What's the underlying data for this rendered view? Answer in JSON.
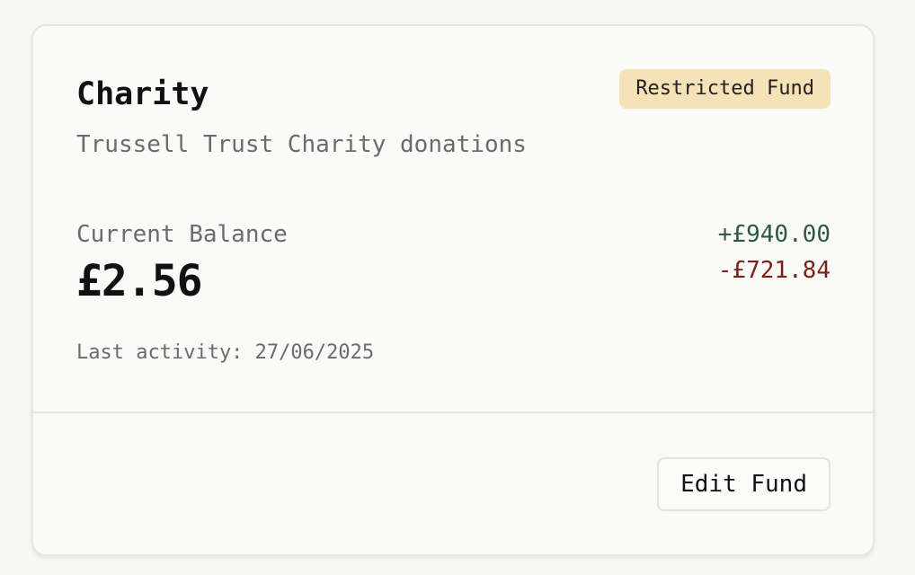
{
  "fund": {
    "name": "Charity",
    "badge": "Restricted Fund",
    "description": "Trussell Trust Charity donations",
    "balance_label": "Current Balance",
    "balance": "£2.56",
    "income": "+£940.00",
    "expense": "-£721.84",
    "last_activity": "Last activity: 27/06/2025"
  },
  "actions": {
    "edit_label": "Edit Fund"
  },
  "colors": {
    "badge_bg": "#f6e2b7",
    "income": "#2f5a3a",
    "expense": "#7a2218"
  }
}
